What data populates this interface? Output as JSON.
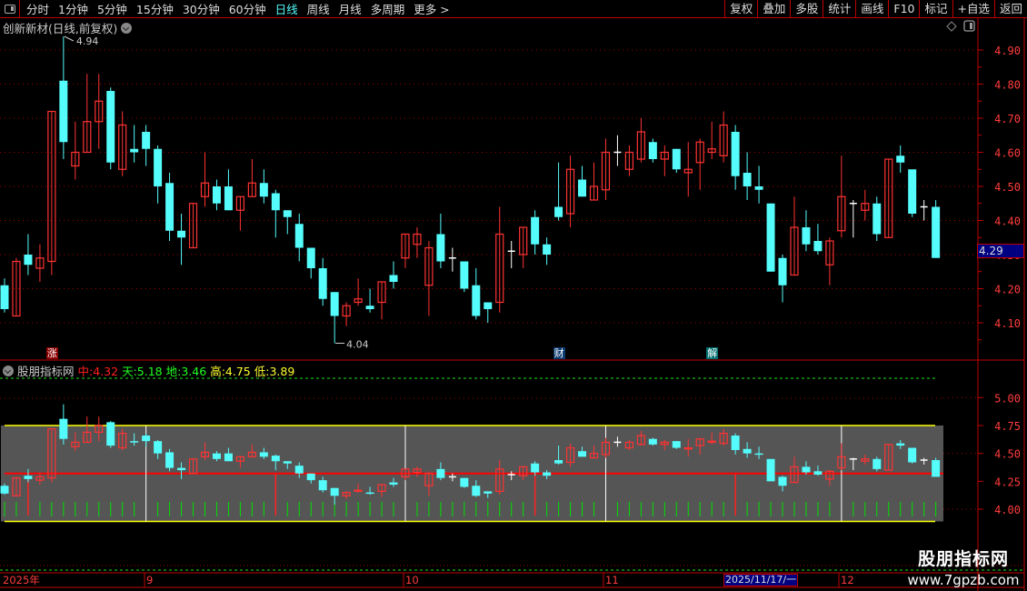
{
  "toolbar": {
    "periods": [
      "分时",
      "1分钟",
      "5分钟",
      "15分钟",
      "30分钟",
      "60分钟",
      "日线",
      "周线",
      "月线",
      "多周期",
      "更多 >"
    ],
    "active_period": "日线",
    "buttons": [
      "复权",
      "叠加",
      "多股",
      "统计",
      "画线",
      "F10",
      "标记",
      "+自选",
      "返回"
    ]
  },
  "chart_title": "创新新材(日线,前复权)",
  "last_price": "4.29",
  "high_marker": "4.94",
  "low_marker": "4.04",
  "event_marks": [
    {
      "label": "涨",
      "color": "#8b0000"
    },
    {
      "label": "财",
      "color": "#0a3a6e"
    },
    {
      "label": "解",
      "color": "#007070"
    }
  ],
  "indicator": {
    "name": "股朋指标网",
    "values": [
      {
        "label": "中:",
        "value": "4.32",
        "color": "#ff2020"
      },
      {
        "label": "天:",
        "value": "5.18",
        "color": "#20ff20"
      },
      {
        "label": "地:",
        "value": "3.46",
        "color": "#20ff20"
      },
      {
        "label": "高:",
        "value": "4.75",
        "color": "#ffff30"
      },
      {
        "label": "低:",
        "value": "3.89",
        "color": "#ffff30"
      }
    ]
  },
  "date_axis": {
    "labels": [
      "2025年",
      "9",
      "10",
      "11",
      "12"
    ],
    "cursor_date": "2025/11/17/一"
  },
  "watermark": {
    "name": "股朋指标网",
    "url": "www.7gpzb.com"
  },
  "colors": {
    "up": "#ff3232",
    "down": "#54fcfc",
    "flat": "#ffffff",
    "axis": "#c00000",
    "axis_text": "#ff3c3c",
    "mid_line": "#ff0000",
    "band_line": "#ffff00",
    "band_fill": "#555555",
    "tick": "#00e000"
  },
  "chart_data": {
    "type": "candlestick",
    "price_axis": {
      "ticks": [
        "4.90",
        "4.80",
        "4.70",
        "4.60",
        "4.50",
        "4.40",
        "4.30",
        "4.20",
        "4.10"
      ],
      "range": [
        4.04,
        4.94
      ]
    },
    "indicator_axis": {
      "ticks": [
        "5.00",
        "4.75",
        "4.50",
        "4.25",
        "4.00"
      ]
    },
    "ohlc": [
      [
        4.21,
        4.23,
        4.13,
        4.14
      ],
      [
        4.12,
        4.29,
        4.12,
        4.28
      ],
      [
        4.3,
        4.36,
        4.24,
        4.27
      ],
      [
        4.26,
        4.33,
        4.22,
        4.29
      ],
      [
        4.28,
        4.72,
        4.24,
        4.72
      ],
      [
        4.81,
        4.94,
        4.58,
        4.63
      ],
      [
        4.56,
        4.69,
        4.52,
        4.6
      ],
      [
        4.6,
        4.83,
        4.6,
        4.69
      ],
      [
        4.69,
        4.83,
        4.61,
        4.75
      ],
      [
        4.78,
        4.79,
        4.55,
        4.57
      ],
      [
        4.55,
        4.72,
        4.53,
        4.68
      ],
      [
        4.61,
        4.68,
        4.57,
        4.6
      ],
      [
        4.66,
        4.68,
        4.56,
        4.61
      ],
      [
        4.61,
        4.62,
        4.45,
        4.5
      ],
      [
        4.51,
        4.54,
        4.34,
        4.37
      ],
      [
        4.37,
        4.42,
        4.27,
        4.35
      ],
      [
        4.32,
        4.45,
        4.32,
        4.45
      ],
      [
        4.47,
        4.6,
        4.44,
        4.51
      ],
      [
        4.5,
        4.52,
        4.43,
        4.45
      ],
      [
        4.5,
        4.55,
        4.43,
        4.43
      ],
      [
        4.43,
        4.47,
        4.37,
        4.47
      ],
      [
        4.47,
        4.58,
        4.47,
        4.51
      ],
      [
        4.51,
        4.55,
        4.45,
        4.47
      ],
      [
        4.48,
        4.49,
        4.35,
        4.43
      ],
      [
        4.43,
        4.43,
        4.36,
        4.41
      ],
      [
        4.39,
        4.42,
        4.28,
        4.32
      ],
      [
        4.32,
        4.32,
        4.23,
        4.26
      ],
      [
        4.26,
        4.29,
        4.15,
        4.17
      ],
      [
        4.19,
        4.19,
        4.04,
        4.12
      ],
      [
        4.12,
        4.16,
        4.09,
        4.15
      ],
      [
        4.16,
        4.23,
        4.15,
        4.17
      ],
      [
        4.15,
        4.2,
        4.13,
        4.14
      ],
      [
        4.16,
        4.22,
        4.11,
        4.22
      ],
      [
        4.24,
        4.28,
        4.2,
        4.22
      ],
      [
        4.29,
        4.36,
        4.26,
        4.36
      ],
      [
        4.33,
        4.38,
        4.29,
        4.36
      ],
      [
        4.21,
        4.34,
        4.12,
        4.32
      ],
      [
        4.36,
        4.42,
        4.26,
        4.28
      ],
      [
        4.29,
        4.32,
        4.25,
        4.29
      ],
      [
        4.28,
        4.28,
        4.19,
        4.2
      ],
      [
        4.21,
        4.26,
        4.11,
        4.12
      ],
      [
        4.16,
        4.16,
        4.1,
        4.14
      ],
      [
        4.16,
        4.44,
        4.13,
        4.36
      ],
      [
        4.31,
        4.34,
        4.26,
        4.31
      ],
      [
        4.3,
        4.38,
        4.26,
        4.38
      ],
      [
        4.41,
        4.43,
        4.3,
        4.33
      ],
      [
        4.33,
        4.35,
        4.27,
        4.3
      ],
      [
        4.44,
        4.57,
        4.4,
        4.41
      ],
      [
        4.42,
        4.59,
        4.38,
        4.55
      ],
      [
        4.52,
        4.56,
        4.47,
        4.47
      ],
      [
        4.46,
        4.57,
        4.46,
        4.5
      ],
      [
        4.49,
        4.64,
        4.46,
        4.6
      ],
      [
        4.6,
        4.65,
        4.56,
        4.6
      ],
      [
        4.55,
        4.62,
        4.53,
        4.6
      ],
      [
        4.58,
        4.7,
        4.57,
        4.66
      ],
      [
        4.63,
        4.64,
        4.57,
        4.58
      ],
      [
        4.58,
        4.62,
        4.53,
        4.6
      ],
      [
        4.61,
        4.61,
        4.54,
        4.55
      ],
      [
        4.54,
        4.63,
        4.47,
        4.55
      ],
      [
        4.57,
        4.64,
        4.49,
        4.63
      ],
      [
        4.6,
        4.69,
        4.58,
        4.61
      ],
      [
        4.59,
        4.72,
        4.57,
        4.68
      ],
      [
        4.66,
        4.68,
        4.49,
        4.53
      ],
      [
        4.54,
        4.6,
        4.46,
        4.5
      ],
      [
        4.5,
        4.56,
        4.45,
        4.49
      ],
      [
        4.45,
        4.45,
        4.25,
        4.25
      ],
      [
        4.29,
        4.3,
        4.16,
        4.21
      ],
      [
        4.24,
        4.47,
        4.24,
        4.38
      ],
      [
        4.38,
        4.43,
        4.31,
        4.33
      ],
      [
        4.34,
        4.39,
        4.3,
        4.31
      ],
      [
        4.27,
        4.35,
        4.21,
        4.34
      ],
      [
        4.37,
        4.59,
        4.35,
        4.47
      ],
      [
        4.45,
        4.46,
        4.35,
        4.45
      ],
      [
        4.43,
        4.49,
        4.4,
        4.45
      ],
      [
        4.45,
        4.47,
        4.34,
        4.36
      ],
      [
        4.35,
        4.58,
        4.35,
        4.58
      ],
      [
        4.59,
        4.62,
        4.54,
        4.57
      ],
      [
        4.55,
        4.55,
        4.41,
        4.42
      ],
      [
        4.44,
        4.46,
        4.4,
        4.44
      ],
      [
        4.44,
        4.46,
        4.3,
        4.29
      ]
    ],
    "indicator": {
      "mid": 4.32,
      "top": 5.18,
      "bottom": 3.46,
      "high": 4.75,
      "low": 3.89
    },
    "month_start_index": [
      12,
      34,
      51,
      71
    ],
    "signal_index": [
      2,
      23,
      45,
      62
    ],
    "event_index": [
      4,
      47,
      60
    ]
  }
}
